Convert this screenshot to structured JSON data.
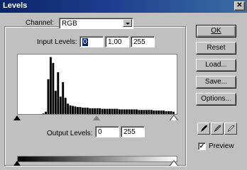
{
  "window": {
    "title": "Levels",
    "close_glyph": "✕"
  },
  "channel": {
    "label": "Channel:",
    "value": "RGB"
  },
  "input_levels": {
    "label": "Input Levels:",
    "black": "0",
    "gamma": "1,00",
    "white": "255"
  },
  "output_levels": {
    "label": "Output Levels:",
    "black": "0",
    "white": "255"
  },
  "buttons": {
    "ok": "OK",
    "reset": "Reset",
    "load": "Load...",
    "save": "Save...",
    "options": "Options..."
  },
  "preview": {
    "label": "Preview",
    "checked": true,
    "check_glyph": "✓"
  },
  "eyedroppers": [
    "black-eyedropper-icon",
    "gray-eyedropper-icon",
    "white-eyedropper-icon"
  ],
  "chart_data": {
    "type": "bar",
    "title": "",
    "xlabel": "",
    "ylabel": "",
    "xlim": [
      0,
      255
    ],
    "ylim": [
      0,
      100
    ],
    "x": [
      0,
      4,
      8,
      12,
      16,
      20,
      24,
      28,
      32,
      36,
      40,
      44,
      48,
      52,
      56,
      60,
      64,
      68,
      72,
      76,
      80,
      84,
      88,
      92,
      96,
      100,
      104,
      108,
      112,
      116,
      120,
      124,
      128,
      132,
      136,
      140,
      144,
      148,
      152,
      156,
      160,
      164,
      168,
      172,
      176,
      180,
      184,
      188,
      192,
      196,
      200,
      204,
      208,
      212,
      216,
      220,
      224,
      228,
      232,
      236,
      240,
      244,
      248,
      252
    ],
    "values": [
      0,
      0,
      0,
      0,
      0,
      0,
      0,
      0,
      0,
      0,
      1,
      4,
      60,
      98,
      88,
      40,
      72,
      30,
      55,
      28,
      18,
      15,
      14,
      13,
      12,
      12,
      11,
      11,
      11,
      10,
      10,
      10,
      10,
      10,
      9,
      9,
      9,
      9,
      9,
      9,
      9,
      8,
      8,
      8,
      8,
      8,
      8,
      8,
      8,
      7,
      7,
      7,
      7,
      7,
      7,
      6,
      6,
      6,
      6,
      6,
      5,
      5,
      5,
      4
    ]
  }
}
